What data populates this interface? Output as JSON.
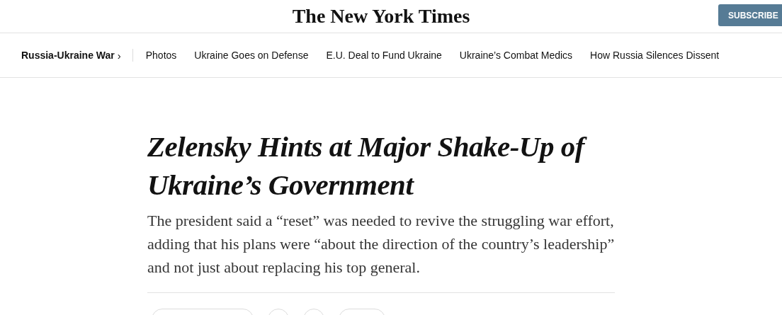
{
  "header": {
    "logo": "The New York Times",
    "subscribe_button": "SUBSCRIBE"
  },
  "nav": {
    "section": "Russia-Ukraine War",
    "section_arrow": "›",
    "links": [
      "Photos",
      "Ukraine Goes on Defense",
      "E.U. Deal to Fund Ukraine",
      "Ukraine’s Combat Medics",
      "How Russia Silences Dissent"
    ]
  },
  "article": {
    "headline": "Zelensky Hints at Major Shake-Up of Ukraine’s Government",
    "summary": "The president said a “reset” was needed to revive the struggling war effort, adding that his plans were “about the direction of the country’s leadership” and not just about replacing his top general."
  },
  "actions": [
    {
      "kind": "wide"
    },
    {
      "kind": "round"
    },
    {
      "kind": "round"
    },
    {
      "kind": "medium"
    }
  ]
}
